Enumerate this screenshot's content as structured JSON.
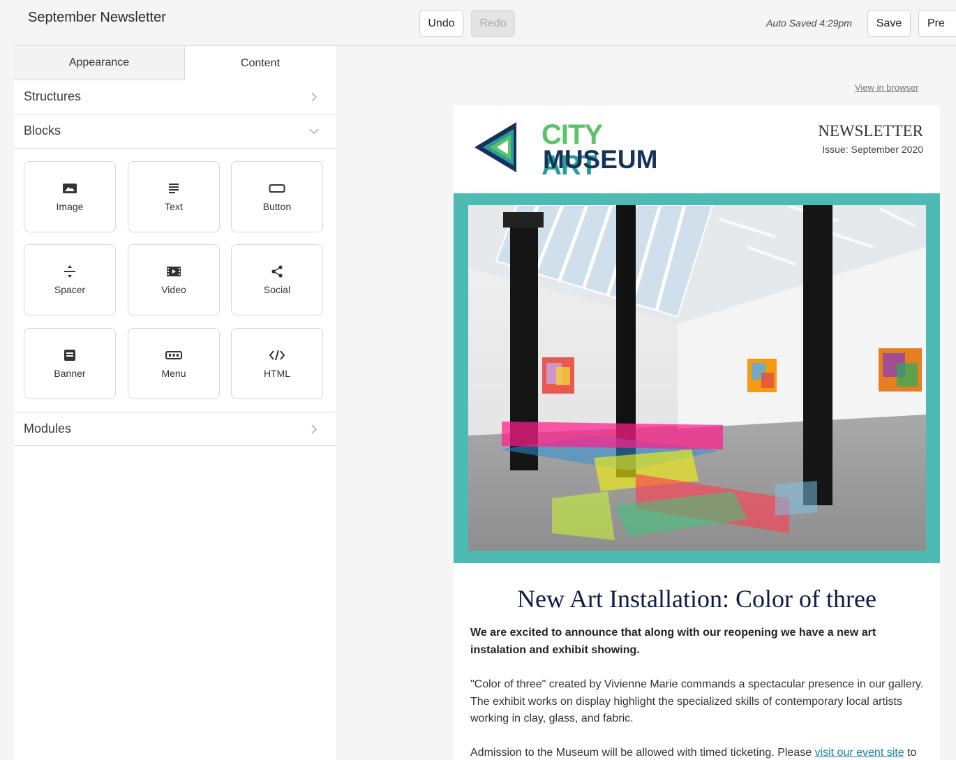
{
  "topbar": {
    "title": "September Newsletter",
    "undo_label": "Undo",
    "redo_label": "Redo",
    "autosave_text": "Auto Saved 4:29pm",
    "save_label": "Save",
    "preview_label": "Pre"
  },
  "sidebar": {
    "tabs": [
      {
        "label": "Appearance"
      },
      {
        "label": "Content"
      }
    ],
    "structures_label": "Structures",
    "blocks_label": "Blocks",
    "modules_label": "Modules",
    "blocks": [
      {
        "label": "Image",
        "icon": "image-icon"
      },
      {
        "label": "Text",
        "icon": "text-icon"
      },
      {
        "label": "Button",
        "icon": "button-icon"
      },
      {
        "label": "Spacer",
        "icon": "spacer-icon"
      },
      {
        "label": "Video",
        "icon": "video-icon"
      },
      {
        "label": "Social",
        "icon": "share-icon"
      },
      {
        "label": "Banner",
        "icon": "banner-icon"
      },
      {
        "label": "Menu",
        "icon": "menu-icon"
      },
      {
        "label": "HTML",
        "icon": "code-icon"
      }
    ]
  },
  "email": {
    "view_in_browser": "View in browser",
    "logo": {
      "city": "CITY",
      "art": "ART",
      "museum": "MUSEUM"
    },
    "newsletter_label": "NEWSLETTER",
    "issue": "Issue: September 2020",
    "headline": "New Art Installation: Color of three",
    "intro": "We are excited to announce that along with our reopening we have a new art instalation and exhibit showing.",
    "body": "\"Color of three\" created by Vivienne Marie commands a spectacular presence in our gallery. The exhibit works on display highlight the specialized skills of contemporary local artists working in clay, glass, and fabric.",
    "admission_prefix": "Admission to the Museum will be allowed with timed ticketing. Please ",
    "admission_link": "visit our event site",
    "admission_suffix": " to"
  },
  "colors": {
    "hero_frame": "#4dbbb3",
    "logo_green": "#5cc26a",
    "logo_teal": "#2a9d9a",
    "logo_navy": "#16315a",
    "headline": "#0d1b45"
  }
}
